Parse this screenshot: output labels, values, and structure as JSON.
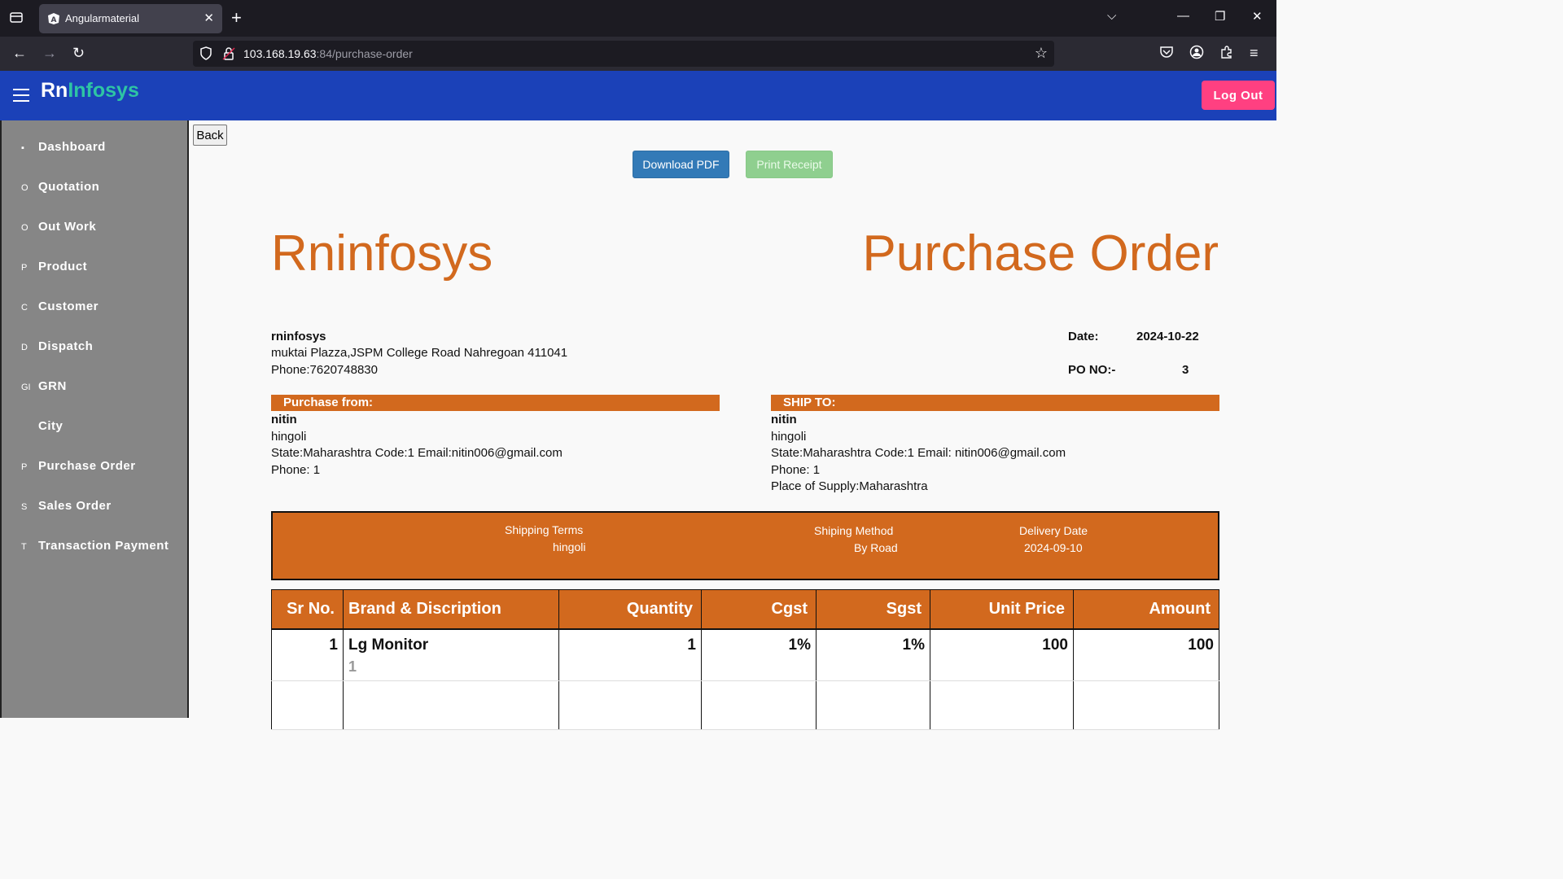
{
  "browser": {
    "tab_title": "Angularmaterial",
    "url_host": "103.168.19.63",
    "url_rest": ":84/purchase-order"
  },
  "app": {
    "brand_part1": "Rn",
    "brand_part2": "Infosys",
    "logout_label": "Log Out",
    "colors": {
      "appbar": "#1b41b8",
      "accent": "#d2691e",
      "logout": "#ff4081",
      "sidebar": "#868686"
    }
  },
  "sidebar": {
    "items": [
      {
        "icon": "dashboard-icon",
        "glyph": "▪",
        "label": "Dashboard"
      },
      {
        "icon": "q-icon",
        "glyph": "O",
        "label": "Quotation"
      },
      {
        "icon": "o-icon",
        "glyph": "O",
        "label": "Out Work"
      },
      {
        "icon": "p-icon",
        "glyph": "P",
        "label": "Product"
      },
      {
        "icon": "c-icon",
        "glyph": "C",
        "label": "Customer"
      },
      {
        "icon": "d-icon",
        "glyph": "D",
        "label": "Dispatch"
      },
      {
        "icon": "gi-icon",
        "glyph": "GI",
        "label": "GRN"
      },
      {
        "icon": "city-icon",
        "glyph": "",
        "label": "City"
      },
      {
        "icon": "p-icon",
        "glyph": "P",
        "label": "Purchase Order"
      },
      {
        "icon": "s-icon",
        "glyph": "S",
        "label": "Sales Order"
      },
      {
        "icon": "t-icon",
        "glyph": "T",
        "label": "Transaction Payment"
      }
    ]
  },
  "content": {
    "back_label": "Back",
    "download_label": "Download PDF",
    "print_label": "Print Receipt",
    "company_title": "Rninfosys",
    "doc_title": "Purchase Order",
    "seller": {
      "name": "rninfosys",
      "address": "muktai Plazza,JSPM College Road Nahregoan 411041",
      "phone": "Phone:7620748830"
    },
    "meta": {
      "date_label": "Date:",
      "date_value": "2024-10-22",
      "po_label": "PO NO:-",
      "po_value": "3"
    },
    "purchase_from": {
      "header": "Purchase from:",
      "name": "nitin",
      "city": "hingoli",
      "state_line": "State:Maharashtra Code:1 Email:nitin006@gmail.com",
      "phone": "Phone: 1"
    },
    "ship_to": {
      "header": "SHIP TO:",
      "name": "nitin",
      "city": "hingoli",
      "state_line": "State:Maharashtra Code:1 Email: nitin006@gmail.com",
      "phone": "Phone: 1",
      "supply": "Place of Supply:Maharashtra"
    },
    "shipping": {
      "terms_label": "Shipping Terms",
      "terms_value": "hingoli",
      "method_label": "Shiping Method",
      "method_value": "By Road",
      "delivery_label": "Delivery Date",
      "delivery_value": "2024-09-10"
    },
    "table": {
      "headers": [
        "Sr No.",
        "Brand & Discription",
        "Quantity",
        "Cgst",
        "Sgst",
        "Unit Price",
        "Amount"
      ],
      "rows": [
        {
          "sr": "1",
          "brand": "Lg Monitor",
          "desc": "1",
          "qty": "1",
          "cgst": "1%",
          "sgst": "1%",
          "unit": "100",
          "amount": "100"
        }
      ]
    }
  }
}
